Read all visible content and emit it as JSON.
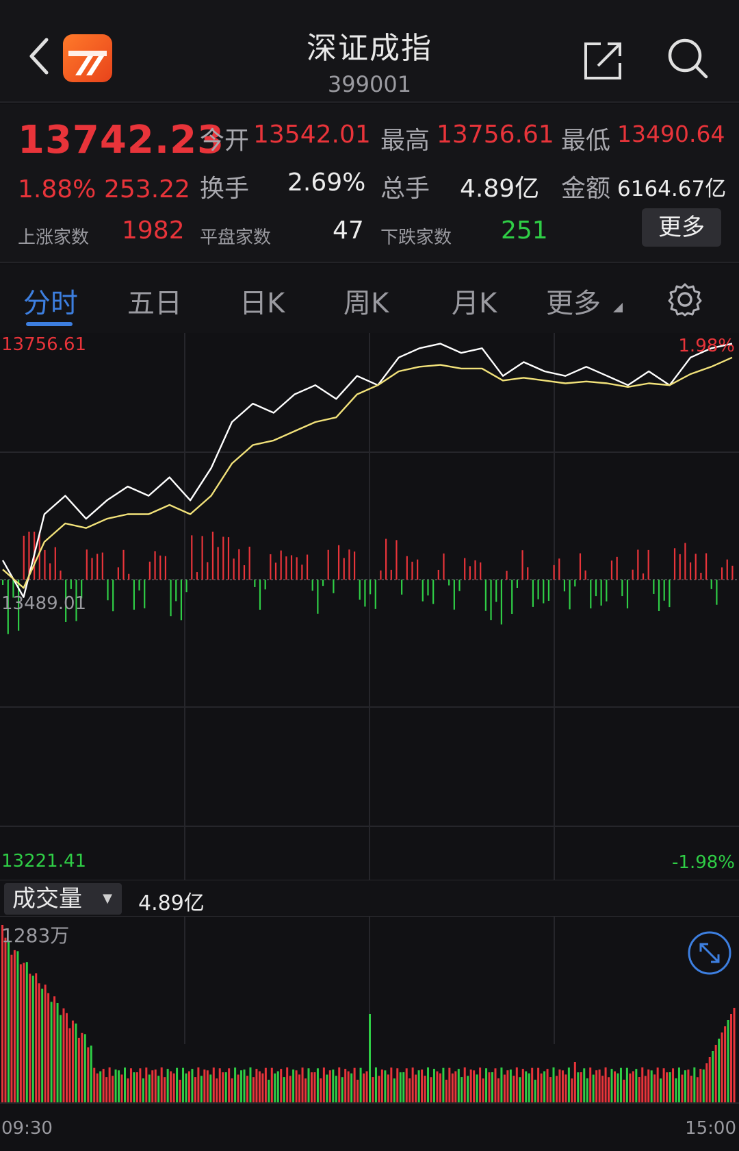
{
  "header": {
    "title": "深证成指",
    "code": "399001"
  },
  "quote": {
    "price": "13742.23",
    "change_pct": "1.88%",
    "change": "253.22",
    "open_label": "今开",
    "open": "13542.01",
    "high_label": "最高",
    "high": "13756.61",
    "low_label": "最低",
    "low": "13490.64",
    "turnover_label": "换手",
    "turnover": "2.69%",
    "volume_label": "总手",
    "volume": "4.89亿",
    "amount_label": "金额",
    "amount": "6164.67亿",
    "up_label": "上涨家数",
    "up": "1982",
    "flat_label": "平盘家数",
    "flat": "47",
    "down_label": "下跌家数",
    "down": "251",
    "more": "更多"
  },
  "tabs": [
    {
      "label": "分时"
    },
    {
      "label": "五日"
    },
    {
      "label": "日K"
    },
    {
      "label": "周K"
    },
    {
      "label": "月K"
    },
    {
      "label": "更多"
    }
  ],
  "axes": {
    "price_top": "13756.61",
    "price_mid": "13489.01",
    "price_bottom": "13221.41",
    "pct_top": "1.98%",
    "pct_bottom": "-1.98%",
    "vol_max": "1283万",
    "time_start": "09:30",
    "time_end": "15:00"
  },
  "volume_panel": {
    "selector": "成交量",
    "total": "4.89亿"
  },
  "colors": {
    "up": "#e8343a",
    "down": "#2fce46",
    "price_line": "#ffffff",
    "avg_line": "#f2e27a",
    "accent": "#3d7fe0"
  },
  "chart_data": {
    "type": "line",
    "x_range": [
      "09:30",
      "15:00"
    ],
    "ylim": [
      13221.41,
      13756.61
    ],
    "base": 13489.01,
    "series": [
      {
        "values": [
          13510,
          13470,
          13560,
          13580,
          13555,
          13575,
          13590,
          13580,
          13600,
          13575,
          13610,
          13660,
          13680,
          13670,
          13690,
          13700,
          13685,
          13710,
          13700,
          13730,
          13740,
          13745,
          13735,
          13740,
          13710,
          13725,
          13715,
          13710,
          13720,
          13710,
          13700,
          13715,
          13700,
          13730,
          13740,
          13745
        ]
      },
      {
        "values": [
          13500,
          13480,
          13530,
          13550,
          13545,
          13555,
          13560,
          13560,
          13570,
          13560,
          13580,
          13615,
          13635,
          13640,
          13650,
          13660,
          13665,
          13690,
          13700,
          13715,
          13720,
          13722,
          13718,
          13718,
          13705,
          13708,
          13705,
          13702,
          13704,
          13702,
          13698,
          13702,
          13700,
          13712,
          13720,
          13730
        ]
      }
    ]
  }
}
